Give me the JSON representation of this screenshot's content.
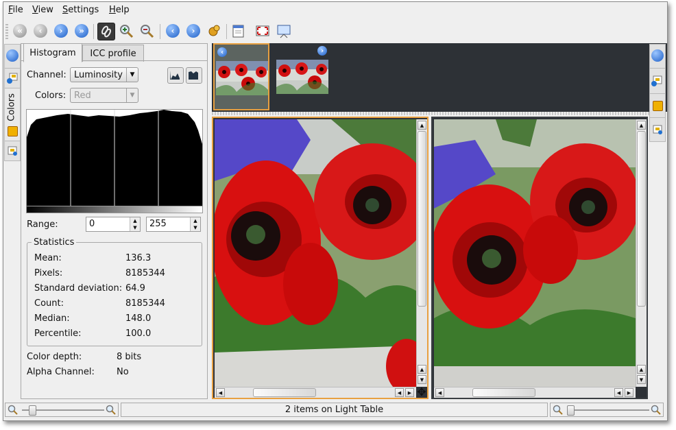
{
  "menubar": {
    "items": [
      {
        "label": "File",
        "mnemonic": "F",
        "rest": "ile"
      },
      {
        "label": "View",
        "mnemonic": "V",
        "rest": "iew"
      },
      {
        "label": "Settings",
        "mnemonic": "S",
        "rest": "ettings"
      },
      {
        "label": "Help",
        "mnemonic": "H",
        "rest": "elp"
      }
    ]
  },
  "toolbar": {
    "icons": [
      "first-icon",
      "back-icon",
      "forward-icon",
      "last-icon",
      "sync-icon",
      "zoom-in-icon",
      "zoom-out-icon",
      "previous-icon",
      "next-icon",
      "edit-icon",
      "clear-icon",
      "fullscreen-icon",
      "slideshow-icon"
    ]
  },
  "left_tabs": {
    "colors_label": "Colors"
  },
  "histogram_panel": {
    "tabs": [
      {
        "label": "Histogram",
        "mnemonic_letter": "H",
        "active": true
      },
      {
        "label": "ICC profile",
        "active": false
      }
    ],
    "channel_label": "Channel:",
    "channel_value": "Luminosity",
    "colors_label": "Colors:",
    "colors_value": "Red",
    "range_label": "Range:",
    "range_min": "0",
    "range_max": "255",
    "statistics_title": "Statistics",
    "statistics": [
      {
        "label": "Mean:",
        "value": "136.3"
      },
      {
        "label": "Pixels:",
        "value": "8185344"
      },
      {
        "label": "Standard deviation:",
        "value": "64.9"
      },
      {
        "label": "Count:",
        "value": "8185344"
      },
      {
        "label": "Median:",
        "value": "148.0"
      },
      {
        "label": "Percentile:",
        "value": "100.0"
      }
    ],
    "color_depth_label": "Color depth:",
    "color_depth_value": "8 bits",
    "alpha_label": "Alpha Channel:",
    "alpha_value": "No"
  },
  "status": {
    "center_text": "2 items on Light Table"
  },
  "colors": {
    "window_bg": "#efefef",
    "thumbbar_bg": "#2d3136",
    "selection": "#e8a040",
    "blue_button": "#1d5fc8"
  }
}
